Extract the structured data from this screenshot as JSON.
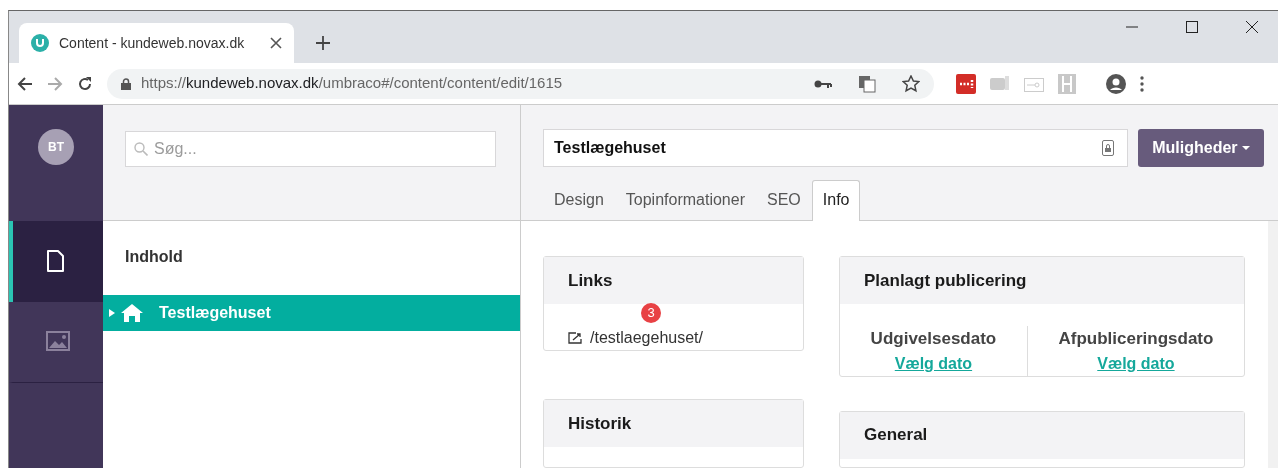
{
  "browser": {
    "tab_title": "Content - kundeweb.novax.dk",
    "url_scheme": "https://",
    "url_host": "kundeweb.novax.dk",
    "url_path": "/umbraco#/content/content/edit/1615"
  },
  "sidebar": {
    "avatar": "BT",
    "sections": [
      {
        "kind": "content",
        "selected": true
      },
      {
        "kind": "media",
        "selected": false
      }
    ]
  },
  "tree": {
    "search_placeholder": "Søg...",
    "heading": "Indhold",
    "items": [
      {
        "label": "Testlægehuset",
        "selected": true,
        "expanded": false
      }
    ]
  },
  "editor": {
    "name": "Testlægehuset",
    "actions_label": "Muligheder",
    "tabs": [
      {
        "label": "Design",
        "selected": false
      },
      {
        "label": "Topinformationer",
        "selected": false
      },
      {
        "label": "SEO",
        "selected": false
      },
      {
        "label": "Info",
        "selected": true
      }
    ]
  },
  "panels": {
    "links": {
      "title": "Links",
      "badge": "3",
      "items": [
        "/testlaegehuset/"
      ]
    },
    "history": {
      "title": "Historik"
    },
    "schedule": {
      "title": "Planlagt publicering",
      "dates": [
        {
          "label": "Udgivelsesdato",
          "action": "Vælg dato"
        },
        {
          "label": "Afpubliceringsdato",
          "action": "Vælg dato"
        }
      ]
    },
    "general": {
      "title": "General"
    }
  }
}
